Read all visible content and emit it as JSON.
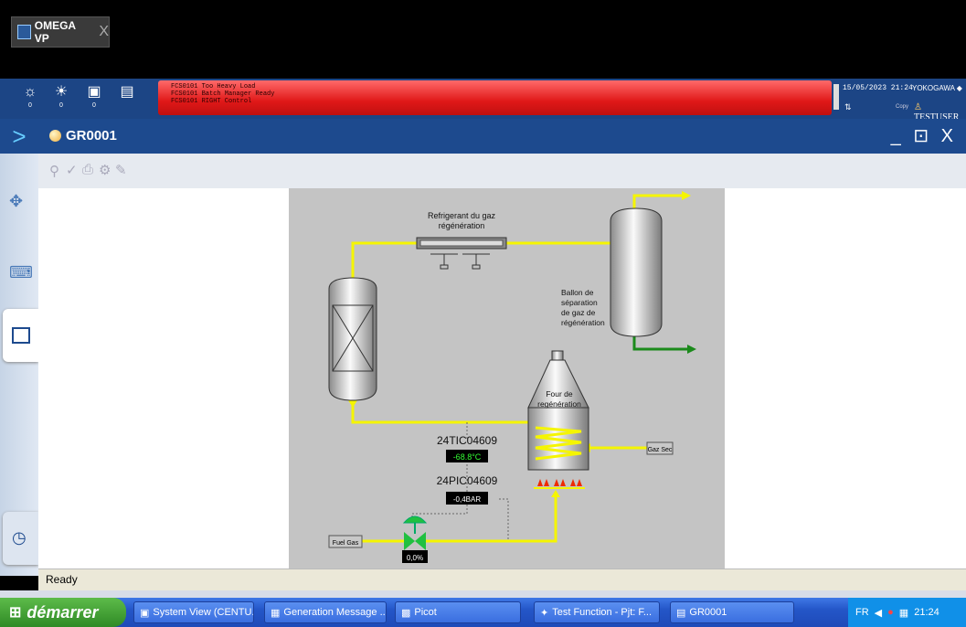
{
  "app_tab": {
    "title": "OMEGA VP",
    "close": "X"
  },
  "toolbar": {
    "icons": [
      "process-alarm-icon",
      "system-alarm-icon",
      "operator-guide-icon",
      "message-icon"
    ],
    "counts": [
      "0",
      "0",
      "0",
      ""
    ]
  },
  "alarms": [
    "FCS0101  Too Heavy Load",
    "FCS0101  Batch Manager Ready",
    "FCS0101  RIGHT    Control"
  ],
  "header_right": {
    "datetime": "15/05/2023 21:24",
    "brand": "YOKOGAWA ◆",
    "user": "TESTUSER",
    "copy": "Copy"
  },
  "window": {
    "title": "GR0001",
    "controls": "_ ⊡ X"
  },
  "diagram": {
    "refrigerant_label_1": "Refrigerant du gaz",
    "refrigerant_label_2": "régénération",
    "ballon_label_1": "Ballon de",
    "ballon_label_2": "séparation",
    "ballon_label_3": "de gaz de",
    "ballon_label_4": "régénération",
    "four_label_1": "Four de",
    "four_label_2": "regénération",
    "tic_tag": "24TIC04609",
    "tic_value": "-68.8°C",
    "pic_tag": "24PIC04609",
    "pic_value": "-0,4BAR",
    "valve_value": "0,0%",
    "fuel_gas": "Fuel Gas",
    "gaz_sec": "Gaz Sec"
  },
  "status": {
    "text": "Ready"
  },
  "taskbar": {
    "start": "démarrer",
    "tasks": [
      "System View (CENTU...",
      "Generation Message ...",
      "Picot",
      "Test Function - Pjt: F...",
      "GR0001"
    ],
    "lang": "FR",
    "time": "21:24"
  },
  "colors": {
    "process_line": "#f5f500",
    "outlet_line": "#1b8a1b",
    "alarm_red": "#e01818",
    "window_bar": "#1d4a8e"
  }
}
